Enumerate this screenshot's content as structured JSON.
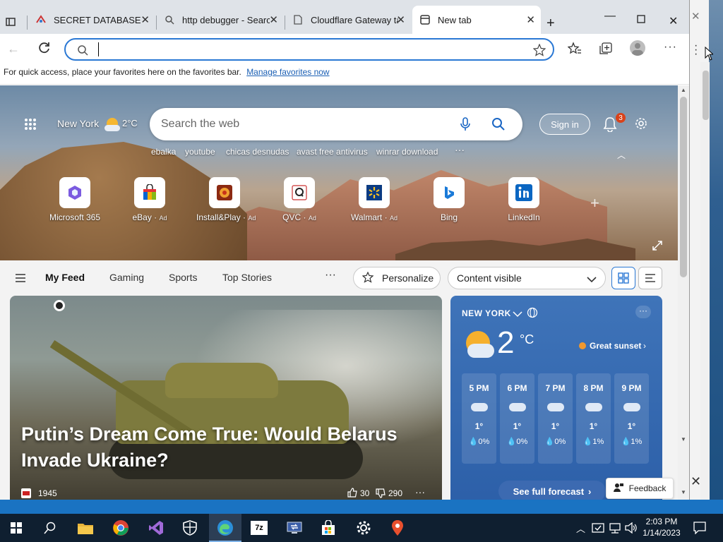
{
  "browser": {
    "tabs": [
      {
        "title": "SECRET DATABASE",
        "icon": "bolt-icon"
      },
      {
        "title": "http debugger - Search",
        "icon": "search-icon"
      },
      {
        "title": "Cloudflare Gateway ta",
        "icon": "document-icon"
      },
      {
        "title": "New tab",
        "icon": "newtab-icon"
      }
    ],
    "address_value": "",
    "favorites_hint": "For quick access, place your favorites here on the favorites bar.",
    "favorites_link": "Manage favorites now"
  },
  "ntp": {
    "location": "New York",
    "temp": "2°C",
    "search_placeholder": "Search the web",
    "sign_in": "Sign in",
    "notif_count": "3",
    "trending": [
      "ebalka",
      "youtube",
      "chicas desnudas",
      "avast free antivirus",
      "winrar download"
    ],
    "tiles": [
      {
        "label": "Microsoft 365",
        "ad": ""
      },
      {
        "label": "eBay",
        "ad": "Ad"
      },
      {
        "label": "Install&Play",
        "ad": "Ad"
      },
      {
        "label": "QVC",
        "ad": "Ad"
      },
      {
        "label": "Walmart",
        "ad": "Ad"
      },
      {
        "label": "Bing",
        "ad": ""
      },
      {
        "label": "LinkedIn",
        "ad": ""
      }
    ]
  },
  "feed": {
    "tabs": [
      "My Feed",
      "Gaming",
      "Sports",
      "Top Stories"
    ],
    "personalize": "Personalize",
    "content_visible": "Content visible",
    "headline": "Putin’s Dream Come True: Would Belarus Invade Ukraine?",
    "source": "1945",
    "likes": "30",
    "dislikes": "290"
  },
  "weather": {
    "location": "NEW YORK",
    "temp": "2",
    "unit": "°C",
    "note": "Great sunset",
    "hours": [
      {
        "time": "5 PM",
        "temp": "1°",
        "precip": "0%"
      },
      {
        "time": "6 PM",
        "temp": "1°",
        "precip": "0%"
      },
      {
        "time": "7 PM",
        "temp": "1°",
        "precip": "0%"
      },
      {
        "time": "8 PM",
        "temp": "1°",
        "precip": "1%"
      },
      {
        "time": "9 PM",
        "temp": "1°",
        "precip": "1%"
      }
    ],
    "forecast_link": "See full forecast"
  },
  "feedback": "Feedback",
  "taskbar": {
    "time": "2:03 PM",
    "date": "1/14/2023"
  }
}
